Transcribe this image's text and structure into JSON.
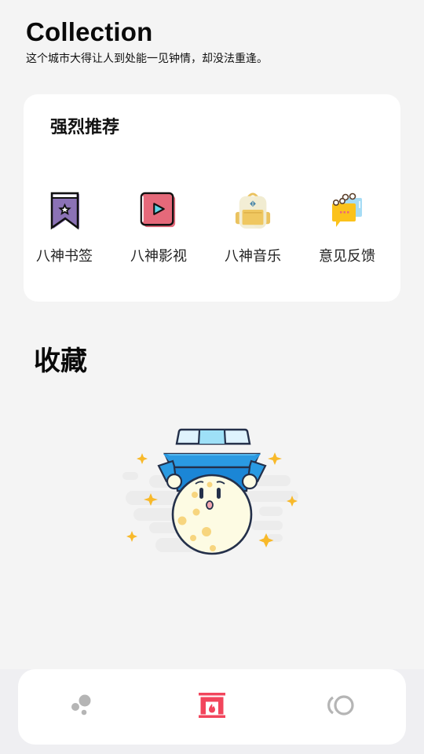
{
  "header": {
    "title": "Collection",
    "subtitle": "这个城市大得让人到处能一见钟情，却没法重逢。"
  },
  "recommend": {
    "title": "强烈推荐",
    "items": [
      {
        "label": "八神书签",
        "icon": "bookmark-icon"
      },
      {
        "label": "八神影视",
        "icon": "video-play-icon"
      },
      {
        "label": "八神音乐",
        "icon": "backpack-icon"
      },
      {
        "label": "意见反馈",
        "icon": "chat-bubbles-icon"
      }
    ]
  },
  "favorites": {
    "title": "收藏",
    "empty_illustration": "moon-carrying-box-illustration"
  },
  "tabbar": {
    "tabs": [
      {
        "name": "discover",
        "icon": "bubbles-icon",
        "active": false
      },
      {
        "name": "collection",
        "icon": "fireplace-icon",
        "active": true
      },
      {
        "name": "profile",
        "icon": "ring-icon",
        "active": false
      }
    ],
    "active_color": "#f2455c",
    "inactive_color": "#b5b5b5"
  },
  "colors": {
    "bookmark": "#8b72b6",
    "video": "#e5697a",
    "backpack": "#f3eed5",
    "chat": "#fbc21b"
  }
}
